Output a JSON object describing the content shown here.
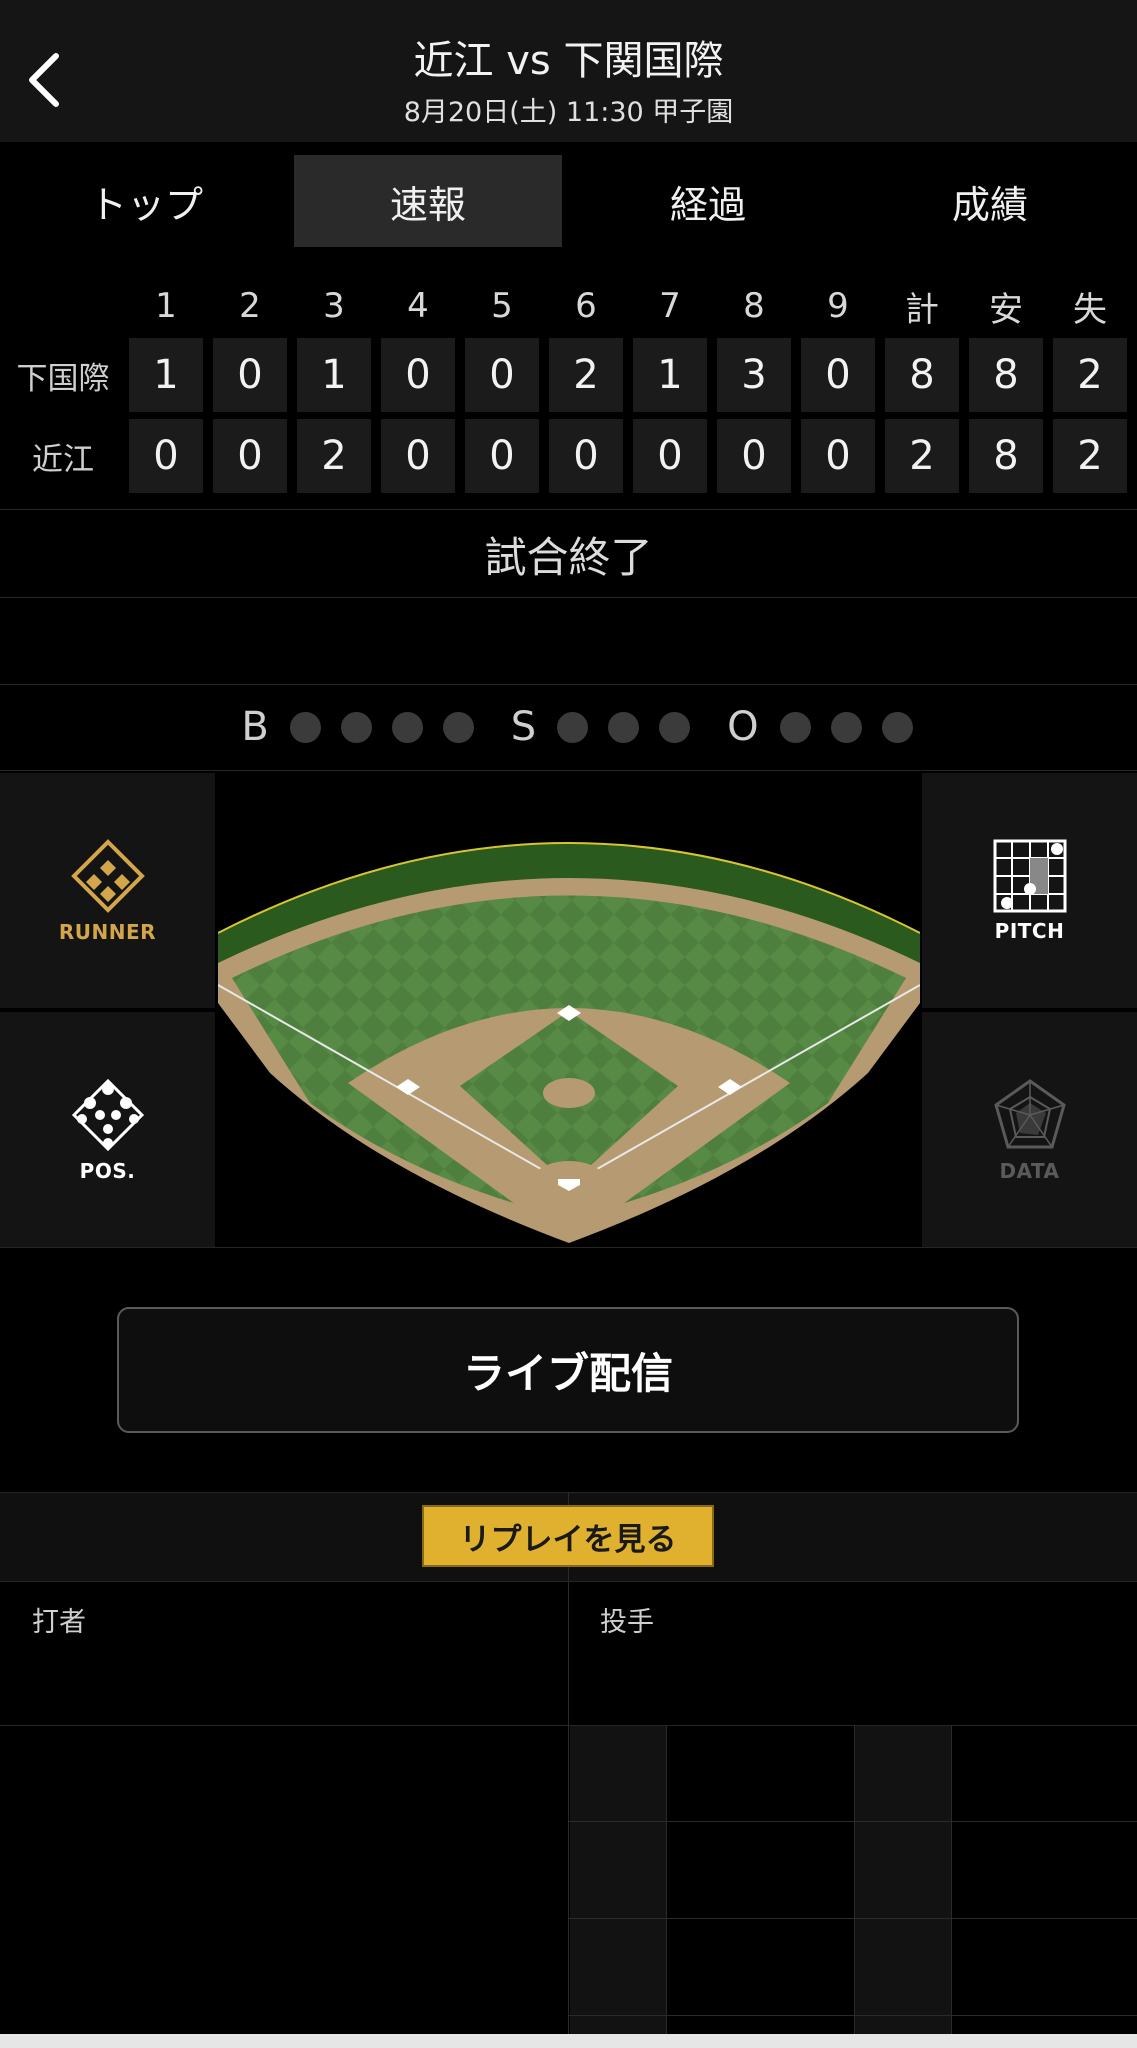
{
  "header": {
    "title": "近江 vs 下関国際",
    "subtitle": "8月20日(土) 11:30 甲子園"
  },
  "tabs": [
    {
      "label": "トップ",
      "active": false
    },
    {
      "label": "速報",
      "active": true
    },
    {
      "label": "経過",
      "active": false
    },
    {
      "label": "成績",
      "active": false
    }
  ],
  "scoreboard": {
    "columns": [
      "1",
      "2",
      "3",
      "4",
      "5",
      "6",
      "7",
      "8",
      "9",
      "計",
      "安",
      "失"
    ],
    "rows": [
      {
        "team": "下国際",
        "scores": [
          "1",
          "0",
          "1",
          "0",
          "0",
          "2",
          "1",
          "3",
          "0",
          "8",
          "8",
          "2"
        ]
      },
      {
        "team": "近江",
        "scores": [
          "0",
          "0",
          "2",
          "0",
          "0",
          "0",
          "0",
          "0",
          "0",
          "2",
          "8",
          "2"
        ]
      }
    ]
  },
  "status": "試合終了",
  "count": {
    "balls": {
      "label": "B",
      "lit": 0,
      "total": 4
    },
    "strikes": {
      "label": "S",
      "lit": 0,
      "total": 3
    },
    "outs": {
      "label": "O",
      "lit": 0,
      "total": 3
    }
  },
  "panels": {
    "runner": {
      "label": "RUNNER",
      "icon": "runner-diamond-icon",
      "color": "#d4a64a"
    },
    "pos": {
      "label": "POS.",
      "icon": "position-dots-icon",
      "color": "#ffffff"
    },
    "pitch": {
      "label": "PITCH",
      "icon": "pitch-grid-icon",
      "color": "#ffffff"
    },
    "data": {
      "label": "DATA",
      "icon": "radar-chart-icon",
      "color": "#5a5a5a"
    }
  },
  "live_button": "ライブ配信",
  "replay_button": "リプレイを見る",
  "batter_label": "打者",
  "pitcher_label": "投手",
  "colors": {
    "accent": "#e0b12f",
    "background": "#000000",
    "runner": "#d4a64a"
  }
}
